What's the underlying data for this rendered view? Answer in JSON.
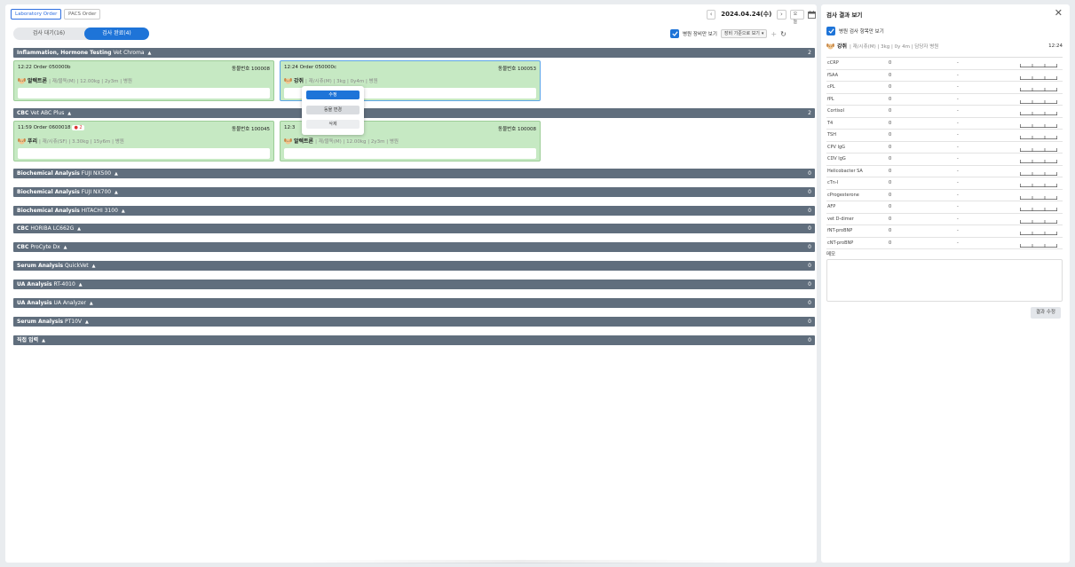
{
  "tabs": [
    {
      "label": "Laboratory Order",
      "active": true
    },
    {
      "label": "PACS Order",
      "active": false
    }
  ],
  "date": {
    "prev": "‹",
    "value": "2024.04.24(수)",
    "next": "›",
    "today": "오늘"
  },
  "segments": [
    {
      "label": "검사 대기(16)",
      "active": false
    },
    {
      "label": "검사 완료(4)",
      "active": true
    }
  ],
  "filters": {
    "registered_only": "병원 장비만 보기",
    "sort_select": "장비 기준으로 보기"
  },
  "sections": [
    {
      "title": "Inflammation, Hormone Testing",
      "sub": "Vet Chroma",
      "count": "2"
    },
    {
      "title": "CBC",
      "sub": "Vet ABC Plus",
      "count": "2"
    },
    {
      "title": "Biochemical Analysis",
      "sub": "FUJI NX500",
      "count": "0"
    },
    {
      "title": "Biochemical Analysis",
      "sub": "FUJI NX700",
      "count": "0"
    },
    {
      "title": "Biochemical Analysis",
      "sub": "HITACHI 3100",
      "count": "0"
    },
    {
      "title": "CBC",
      "sub": "HORIBA LC662G",
      "count": "0"
    },
    {
      "title": "CBC",
      "sub": "ProCyte Dx",
      "count": "0"
    },
    {
      "title": "Serum Analysis",
      "sub": "QuickVet",
      "count": "0"
    },
    {
      "title": "UA Analysis",
      "sub": "RT-4010",
      "count": "0"
    },
    {
      "title": "UA Analysis",
      "sub": "UA Analyzer",
      "count": "0"
    },
    {
      "title": "Serum Analysis",
      "sub": "PT10V",
      "count": "0"
    },
    {
      "title": "직접 입력",
      "sub": "",
      "count": "0"
    }
  ],
  "cards": [
    {
      "header": "12:22  Order 050000b",
      "reg": "동물번호 100008",
      "name": "알렉트론",
      "info": "| 재/블독(M) | 12.00kg | 2y3m | 병원",
      "badge": ""
    },
    {
      "header": "12:24  Order 050000c",
      "reg": "동물번호 100053",
      "name": "강쥐",
      "info": "| 재/시츄(M) | 3kg | 0y4m | 병원",
      "badge": ""
    },
    {
      "header": "11:59  Order 0600018",
      "reg": "동물번호 100045",
      "name": "푸리",
      "info": "| 재/시츄(SF) | 3.30kg | 15y6m | 병원",
      "badge": "● 2"
    },
    {
      "header": "12:3",
      "reg": "동물번호 100008",
      "name": "알렉트론",
      "info": "| 재/블독(M) | 12.00kg | 2y3m | 병원",
      "badge": ""
    }
  ],
  "context_menu": {
    "edit": "수정",
    "change_animal": "동물 변경",
    "delete": "삭제"
  },
  "right_panel": {
    "title": "검사 결과 보기",
    "checkbox_label": "병원 검사 항목만 보기",
    "patient_name": "강쥐",
    "patient_info": "| 재/시츄(M) | 3kg | 0y 4m | 담당자 병원",
    "time": "12:24",
    "results": [
      {
        "name": "cCRP",
        "value": "0",
        "unit": "-"
      },
      {
        "name": "fSAA",
        "value": "0",
        "unit": "-"
      },
      {
        "name": "cPL",
        "value": "0",
        "unit": "-"
      },
      {
        "name": "fPL",
        "value": "0",
        "unit": "-"
      },
      {
        "name": "Cortisol",
        "value": "0",
        "unit": "-"
      },
      {
        "name": "T4",
        "value": "0",
        "unit": "-"
      },
      {
        "name": "TSH",
        "value": "0",
        "unit": "-"
      },
      {
        "name": "CPV IgG",
        "value": "0",
        "unit": "-"
      },
      {
        "name": "CDV IgG",
        "value": "0",
        "unit": "-"
      },
      {
        "name": "Helicobacter SA",
        "value": "0",
        "unit": "-"
      },
      {
        "name": "cTn-I",
        "value": "0",
        "unit": "-"
      },
      {
        "name": "cProgesterone",
        "value": "0",
        "unit": "-"
      },
      {
        "name": "AFP",
        "value": "0",
        "unit": "-"
      },
      {
        "name": "vet D-dimer",
        "value": "0",
        "unit": "-"
      },
      {
        "name": "fNT-proBNP",
        "value": "0",
        "unit": "-"
      },
      {
        "name": "cNT-proBNP",
        "value": "0",
        "unit": "-"
      }
    ],
    "memo_label": "메모",
    "edit_button": "결과 수정"
  },
  "colors": {
    "primary": "#1e74d8",
    "section_bg": "#606e7d",
    "card_bg": "#c6e9c3"
  }
}
